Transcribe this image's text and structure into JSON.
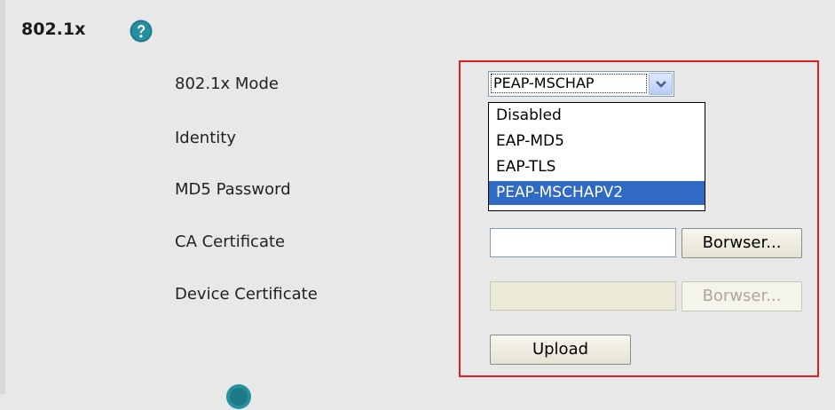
{
  "section": {
    "title": "802.1x",
    "help_icon": "help-icon"
  },
  "form": {
    "mode_label": "802.1x Mode",
    "identity_label": "Identity",
    "md5_password_label": "MD5 Password",
    "ca_certificate_label": "CA Certificate",
    "device_certificate_label": "Device Certificate"
  },
  "mode_select": {
    "value": "PEAP-MSCHAP",
    "options": [
      "Disabled",
      "EAP-MD5",
      "EAP-TLS",
      "PEAP-MSCHAPV2"
    ],
    "selected_option": "PEAP-MSCHAPV2"
  },
  "ca_certificate": {
    "value": "",
    "browse_label": "Borwser..."
  },
  "device_certificate": {
    "value": "",
    "browse_label": "Borwser..."
  },
  "upload_label": "Upload",
  "colors": {
    "highlight_frame": "#e02020",
    "selected_option_bg": "#316ac5",
    "help_icon": "#1d7a88"
  }
}
